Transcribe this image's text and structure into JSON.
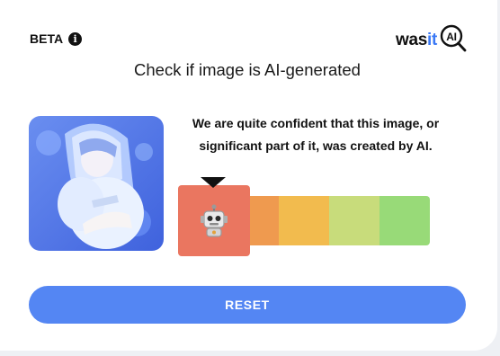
{
  "header": {
    "beta_label": "BETA",
    "logo_text_was": "was",
    "logo_text_it": "it",
    "logo_text_ai": "AI"
  },
  "title": "Check if image is AI-generated",
  "result": {
    "verdict_line1": "We are quite confident that this image, or",
    "verdict_line2": "significant part of it, was created by AI.",
    "scale_level": 1,
    "scale_levels": 5,
    "scale_colors": [
      "#ea7660",
      "#ef9a4f",
      "#f2bb4e",
      "#c8dc7b",
      "#98da78"
    ],
    "indicator_icon": "robot-icon"
  },
  "image_preview_icon": "anime-illustration-thumbnail",
  "actions": {
    "reset_label": "RESET"
  },
  "colors": {
    "accent": "#5486f3",
    "logo_accent": "#3b79f5"
  }
}
